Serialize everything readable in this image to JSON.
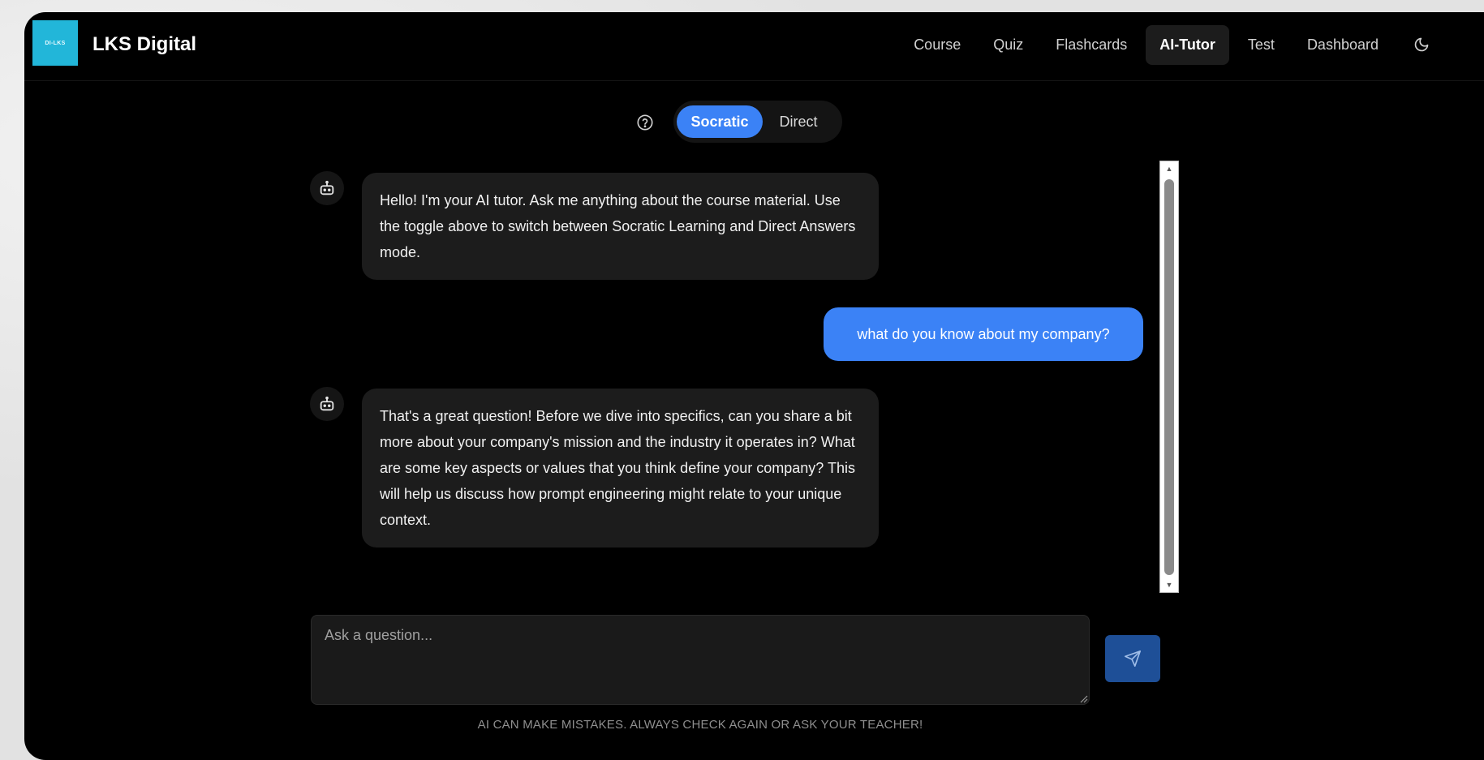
{
  "header": {
    "logo_text": "DI-LKS",
    "brand": "LKS Digital",
    "nav": [
      {
        "label": "Course",
        "active": false
      },
      {
        "label": "Quiz",
        "active": false
      },
      {
        "label": "Flashcards",
        "active": false
      },
      {
        "label": "AI-Tutor",
        "active": true
      },
      {
        "label": "Test",
        "active": false
      },
      {
        "label": "Dashboard",
        "active": false
      }
    ],
    "theme_icon": "moon-icon"
  },
  "mode_toggle": {
    "help_icon": "question-circle-icon",
    "options": [
      {
        "label": "Socratic",
        "selected": true
      },
      {
        "label": "Direct",
        "selected": false
      }
    ]
  },
  "messages": [
    {
      "role": "assistant",
      "avatar_icon": "robot-icon",
      "text": "Hello! I'm your AI tutor. Ask me anything about the course material. Use the toggle above to switch between Socratic Learning and Direct Answers mode."
    },
    {
      "role": "user",
      "text": "what do you know about my company?"
    },
    {
      "role": "assistant",
      "avatar_icon": "robot-icon",
      "text": "That's a great question! Before we dive into specifics, can you share a bit more about your company's mission and the industry it operates in? What are some key aspects or values that you think define your company? This will help us discuss how prompt engineering might relate to your unique context."
    }
  ],
  "composer": {
    "placeholder": "Ask a question...",
    "value": "",
    "send_icon": "send-icon"
  },
  "disclaimer": "AI CAN MAKE MISTAKES. ALWAYS CHECK AGAIN OR ASK YOUR TEACHER!",
  "colors": {
    "accent": "#3b82f6",
    "logo": "#22b6d9",
    "background": "#000000",
    "bubble": "#1c1c1c"
  }
}
